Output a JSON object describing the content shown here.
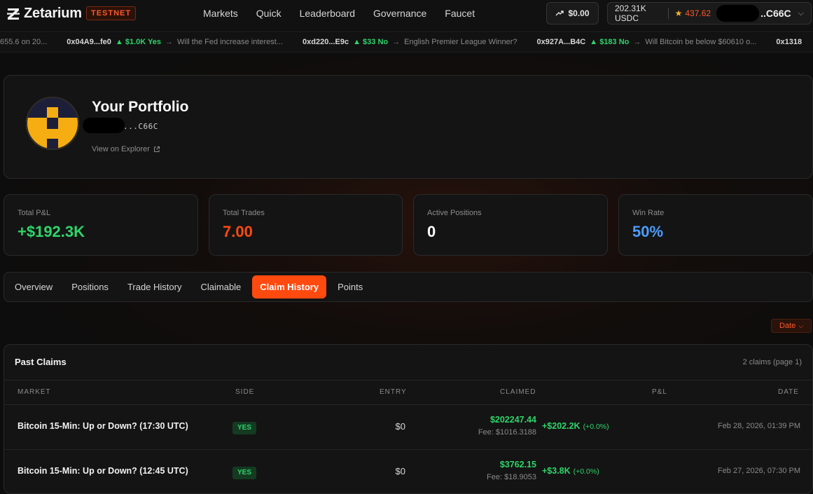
{
  "brand": {
    "name": "Zetarium",
    "network_badge": "TESTNET"
  },
  "nav": {
    "links": [
      "Markets",
      "Quick",
      "Leaderboard",
      "Governance",
      "Faucet"
    ]
  },
  "header": {
    "pnl_value": "$0.00",
    "usdc_balance": "202.31K USDC",
    "points": "437.62",
    "address_short": "..C66C"
  },
  "ticker": {
    "lead": "655.6 on 20...",
    "items": [
      {
        "addr": "0x04A9...fe0",
        "amount": "▲ $1.0K Yes",
        "question": "Will the Fed increase interest..."
      },
      {
        "addr": "0xd220...E9c",
        "amount": "▲ $33 No",
        "question": "English Premier League Winner?"
      },
      {
        "addr": "0x927A...B4C",
        "amount": "▲ $183 No",
        "question": "Will Bitcoin be below $60610 o..."
      },
      {
        "addr": "0x1318",
        "amount": "",
        "question": ""
      }
    ]
  },
  "profile": {
    "title": "Your Portfolio",
    "address_suffix": "...C66C",
    "explorer_link": "View on Explorer"
  },
  "stats": [
    {
      "label": "Total P&L",
      "value": "+$192.3K",
      "color": "#2fd46a"
    },
    {
      "label": "Total Trades",
      "value": "7.00",
      "color": "#ff4a0f"
    },
    {
      "label": "Active Positions",
      "value": "0",
      "color": "#ffffff"
    },
    {
      "label": "Win Rate",
      "value": "50%",
      "color": "#4c9dff"
    }
  ],
  "tabs": [
    "Overview",
    "Positions",
    "Trade History",
    "Claimable",
    "Claim History",
    "Points"
  ],
  "active_tab": "Claim History",
  "sort": {
    "label": "Date"
  },
  "claims": {
    "title": "Past Claims",
    "count": "2 claims (page 1)",
    "columns": [
      "MARKET",
      "SIDE",
      "ENTRY",
      "CLAIMED",
      "P&L",
      "DATE"
    ],
    "rows": [
      {
        "market": "Bitcoin 15-Min: Up or Down? (17:30 UTC)",
        "side": "YES",
        "entry": "$0",
        "claimed": "$202247.44",
        "fee": "Fee: $1016.3188",
        "pnl": "+$202.2K",
        "pnl_pct": "(+0.0%)",
        "date": "Feb 28, 2026, 01:39 PM"
      },
      {
        "market": "Bitcoin 15-Min: Up or Down? (12:45 UTC)",
        "side": "YES",
        "entry": "$0",
        "claimed": "$3762.15",
        "fee": "Fee: $18.9053",
        "pnl": "+$3.8K",
        "pnl_pct": "(+0.0%)",
        "date": "Feb 27, 2026, 07:30 PM"
      }
    ]
  },
  "colors": {
    "accent": "#ff4a0f",
    "positive": "#2fd46a",
    "info": "#4c9dff",
    "avatar_yellow": "#f5ad12",
    "avatar_navy": "#1d1f3a"
  }
}
